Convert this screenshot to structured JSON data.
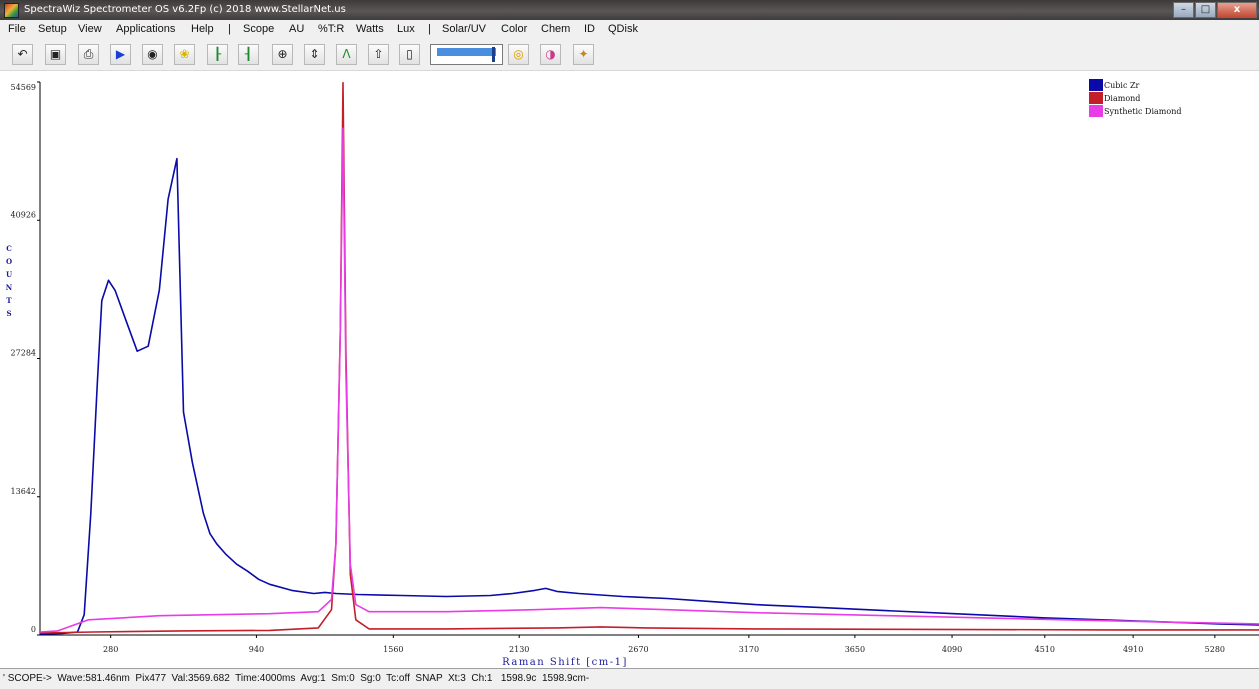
{
  "window": {
    "title": "SpectraWiz  Spectrometer OS v6.2Fp (c) 2018    www.StellarNet.us",
    "minimize": "–",
    "maximize": "□",
    "close": "x"
  },
  "menu": [
    "File",
    "Setup",
    "View",
    "Applications",
    "Help",
    "|",
    "Scope",
    "AU",
    "%T:R",
    "Watts",
    "Lux",
    "|",
    "Solar/UV",
    "Color",
    "Chem",
    "ID",
    "QDisk"
  ],
  "toolbar": {
    "buttons": [
      {
        "icon": "undo-icon",
        "glyph": "↶"
      },
      {
        "icon": "save-icon",
        "glyph": "▣"
      },
      {
        "icon": "print-icon",
        "glyph": "⎙"
      },
      {
        "icon": "play-icon",
        "glyph": "▶"
      },
      {
        "icon": "pin-icon",
        "glyph": "◉"
      },
      {
        "icon": "lightbulb-icon",
        "glyph": "❀"
      },
      {
        "icon": "cursor-left-icon",
        "glyph": "┠"
      },
      {
        "icon": "cursor-right-icon",
        "glyph": "┨"
      },
      {
        "icon": "zoom-icon",
        "glyph": "⊕"
      },
      {
        "icon": "autoscale-y-icon",
        "glyph": "⇕"
      },
      {
        "icon": "peak-icon",
        "glyph": "Λ"
      },
      {
        "icon": "export-icon",
        "glyph": "⇧"
      },
      {
        "icon": "clear-icon",
        "glyph": "▯"
      },
      {
        "icon": "target-icon",
        "glyph": "◎"
      },
      {
        "icon": "color-wheel-icon",
        "glyph": "◑"
      },
      {
        "icon": "settings-icon",
        "glyph": "✦"
      }
    ],
    "slider_level": 0.95,
    "colors": {
      "play": "#1a3fd6",
      "lightbulb": "#d8b400",
      "target": "#d69a00",
      "color_wheel": "#c93a8a",
      "cursor": "#1c8a2c"
    }
  },
  "chart_data": {
    "type": "line",
    "ylabel": "COUNTS",
    "xlabel": "Raman Shift [cm-1]",
    "ylim": [
      0,
      54569
    ],
    "xlim": [
      -40,
      5480
    ],
    "yticks": [
      "0",
      "13642",
      "27284",
      "40926",
      "54569"
    ],
    "xticks": [
      "280",
      "940",
      "1560",
      "2130",
      "2670",
      "3170",
      "3650",
      "4090",
      "4510",
      "4910",
      "5280"
    ],
    "grid": false,
    "legend_placement": "top-right",
    "series": [
      {
        "name": "Cubic Zr",
        "color": "#0a0aa8",
        "x": [
          -40,
          60,
          130,
          160,
          190,
          220,
          240,
          270,
          300,
          350,
          400,
          450,
          500,
          540,
          580,
          610,
          650,
          700,
          730,
          760,
          800,
          850,
          900,
          950,
          1000,
          1100,
          1200,
          1250,
          1300,
          1400,
          1600,
          1800,
          2000,
          2100,
          2200,
          2250,
          2300,
          2400,
          2600,
          2800,
          3000,
          3200,
          3500,
          3800,
          4100,
          4500,
          4900,
          5300,
          5480
        ],
        "y": [
          100,
          150,
          300,
          2000,
          12000,
          25000,
          33000,
          35000,
          34000,
          31000,
          28000,
          28500,
          34000,
          43000,
          47000,
          22000,
          17000,
          12000,
          10000,
          9000,
          8000,
          7000,
          6300,
          5500,
          5000,
          4400,
          4100,
          4200,
          4100,
          4000,
          3900,
          3800,
          3900,
          4100,
          4400,
          4600,
          4300,
          4100,
          3800,
          3600,
          3300,
          3000,
          2700,
          2400,
          2100,
          1700,
          1400,
          1100,
          1000
        ]
      },
      {
        "name": "Diamond",
        "color": "#c41e2a",
        "x": [
          -40,
          200,
          600,
          1000,
          1220,
          1280,
          1300,
          1320,
          1332,
          1345,
          1365,
          1390,
          1450,
          1800,
          2300,
          2500,
          2700,
          3200,
          4000,
          4800,
          5480
        ],
        "y": [
          200,
          300,
          400,
          450,
          700,
          2500,
          9000,
          30000,
          54500,
          28000,
          6000,
          1500,
          600,
          600,
          700,
          800,
          700,
          600,
          550,
          500,
          500
        ]
      },
      {
        "name": "Synthetic Diamond",
        "color": "#e83ce6",
        "x": [
          -40,
          40,
          180,
          500,
          1000,
          1220,
          1280,
          1300,
          1320,
          1332,
          1345,
          1365,
          1390,
          1450,
          1800,
          2200,
          2500,
          2800,
          3200,
          3800,
          4400,
          5000,
          5480
        ],
        "y": [
          300,
          400,
          1500,
          1900,
          2100,
          2300,
          3500,
          9000,
          30000,
          50000,
          26000,
          7000,
          3000,
          2300,
          2300,
          2500,
          2700,
          2500,
          2200,
          1900,
          1600,
          1300,
          1100
        ]
      }
    ]
  },
  "status": {
    "text": "' SCOPE->  Wave:581.46nm  Pix477  Val:3569.682  Time:4000ms  Avg:1  Sm:0  Sg:0  Tc:off  SNAP  Xt:3  Ch:1   1598.9c  1598.9cm-"
  }
}
